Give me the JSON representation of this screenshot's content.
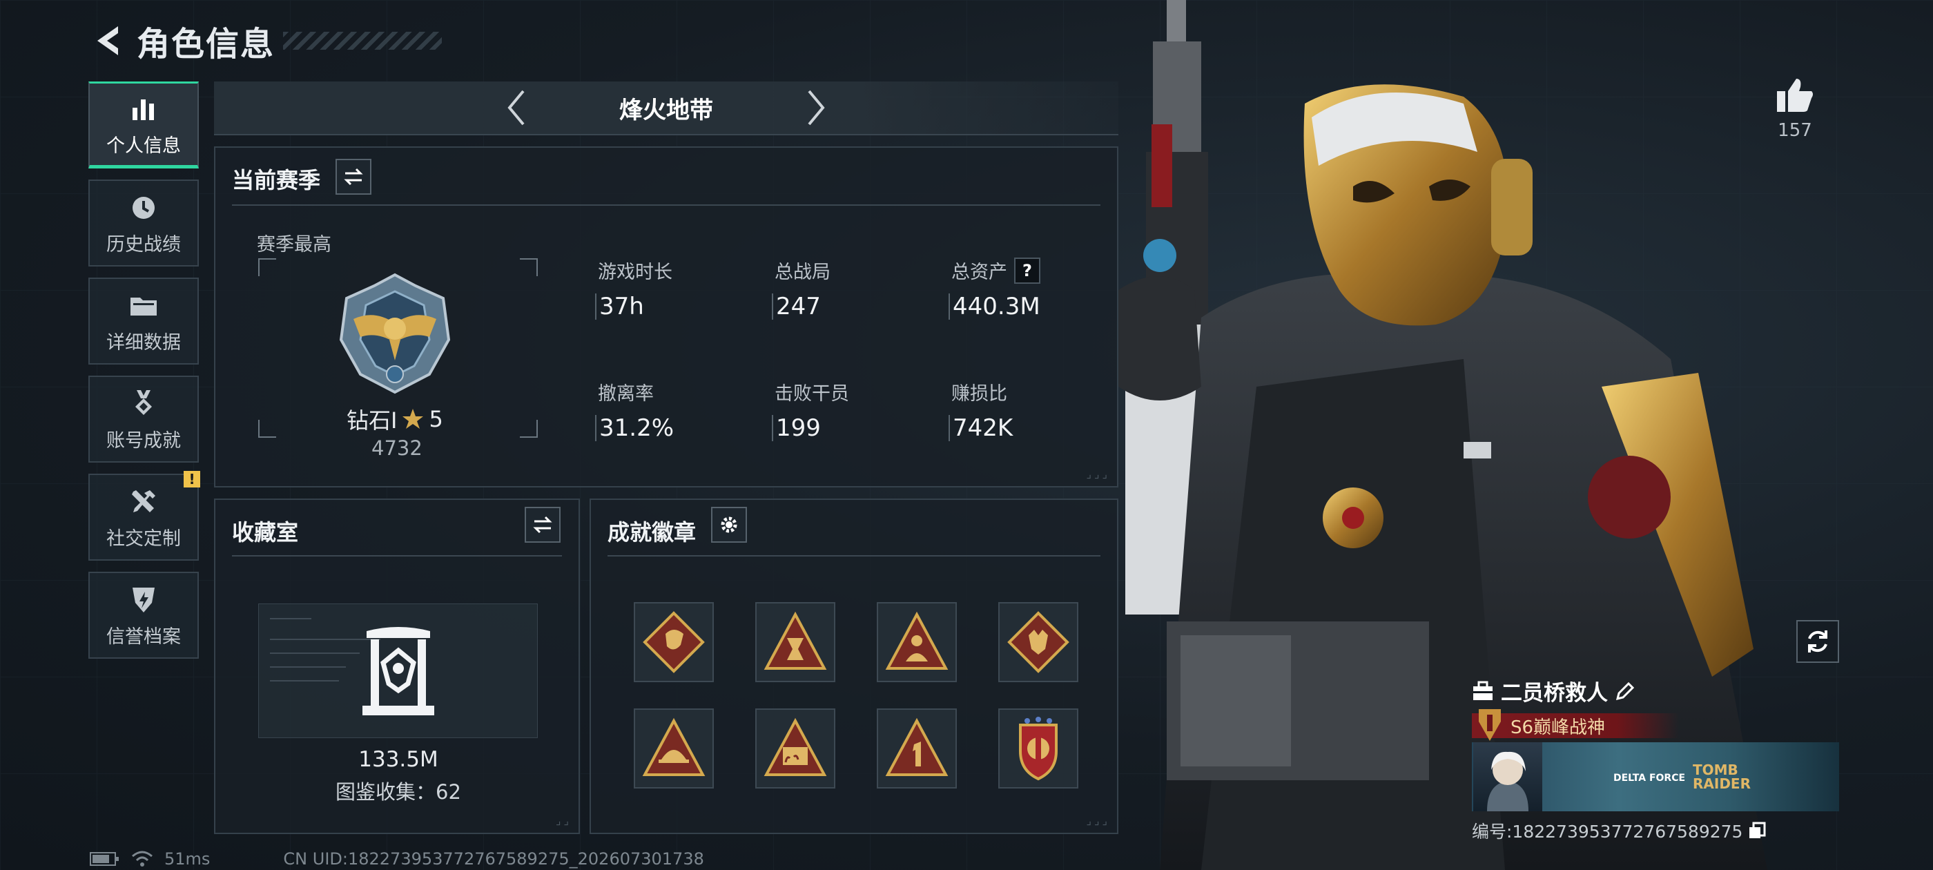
{
  "header": {
    "title": "角色信息"
  },
  "sidebar": {
    "items": [
      {
        "label": "个人信息",
        "icon": "bar-chart-icon",
        "active": true
      },
      {
        "label": "历史战绩",
        "icon": "clock-icon"
      },
      {
        "label": "详细数据",
        "icon": "folder-icon"
      },
      {
        "label": "账号成就",
        "icon": "medal-icon"
      },
      {
        "label": "社交定制",
        "icon": "tools-icon",
        "badge": "!"
      },
      {
        "label": "信誉档案",
        "icon": "shield-bolt-icon"
      }
    ]
  },
  "mode": {
    "name": "烽火地带"
  },
  "season": {
    "title": "当前赛季",
    "best_label": "赛季最高",
    "rank_name": "钻石I",
    "rank_stars": "5",
    "rank_score": "4732",
    "stats": [
      {
        "label": "游戏时长",
        "value": "37h"
      },
      {
        "label": "总战局",
        "value": "247"
      },
      {
        "label": "总资产",
        "value": "440.3M",
        "help": "?"
      },
      {
        "label": "撤离率",
        "value": "31.2%"
      },
      {
        "label": "击败干员",
        "value": "199"
      },
      {
        "label": "赚损比",
        "value": "742K"
      }
    ]
  },
  "collection": {
    "title": "收藏室",
    "value": "133.5M",
    "count_text": "图鉴收集：62"
  },
  "badges": {
    "title": "成就徽章",
    "items": [
      "dragon-badge-icon",
      "hourglass-badge-icon",
      "soldier-badge-icon",
      "wolf-badge-icon",
      "helmet-badge-icon",
      "s6-badge-icon",
      "number-one-badge-icon",
      "shield-emblem-badge-icon"
    ]
  },
  "character": {
    "likes": "157",
    "title": "二员桥救人",
    "rank_tag": "S6巅峰战神",
    "banner_logos": [
      "DELTA FORCE",
      "TOMB RAIDER"
    ],
    "id_text": "编号:1822739537727675892​75"
  },
  "footer": {
    "ping": "51ms",
    "uid": "CN UID:1822739537727675892​75_202607301738"
  },
  "colors": {
    "accent": "#2fd6a0",
    "gold": "#d4a94e",
    "warning": "#f0c24a",
    "panel_border": "#35414b"
  }
}
